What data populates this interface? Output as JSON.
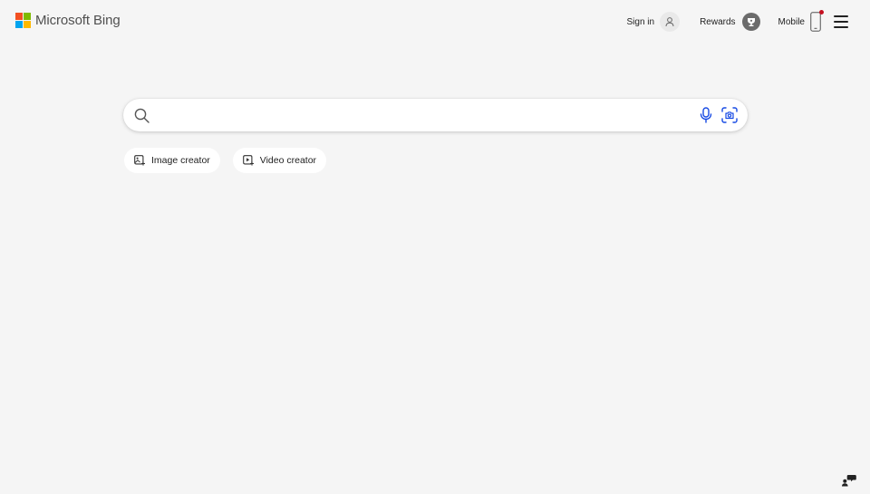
{
  "brand": {
    "name": "Microsoft Bing",
    "logo_colors": [
      "#f25022",
      "#7fba00",
      "#00a4ef",
      "#ffb900"
    ],
    "accent": "#174ae4"
  },
  "header": {
    "signin_label": "Sign in",
    "signin_icon": "person-icon",
    "rewards_label": "Rewards",
    "rewards_icon": "trophy-icon",
    "mobile_label": "Mobile",
    "mobile_icon": "phone-icon",
    "mobile_notification_color": "#c50f1f",
    "menu_icon": "hamburger-menu-icon"
  },
  "search": {
    "value": "",
    "placeholder": "",
    "search_icon": "search-icon",
    "voice_icon": "microphone-icon",
    "visual_search_icon": "camera-visual-search-icon"
  },
  "chips": [
    {
      "label": "Image creator",
      "icon": "image-creator-icon"
    },
    {
      "label": "Video creator",
      "icon": "video-creator-icon"
    }
  ],
  "footer": {
    "feedback_icon": "feedback-icon"
  }
}
